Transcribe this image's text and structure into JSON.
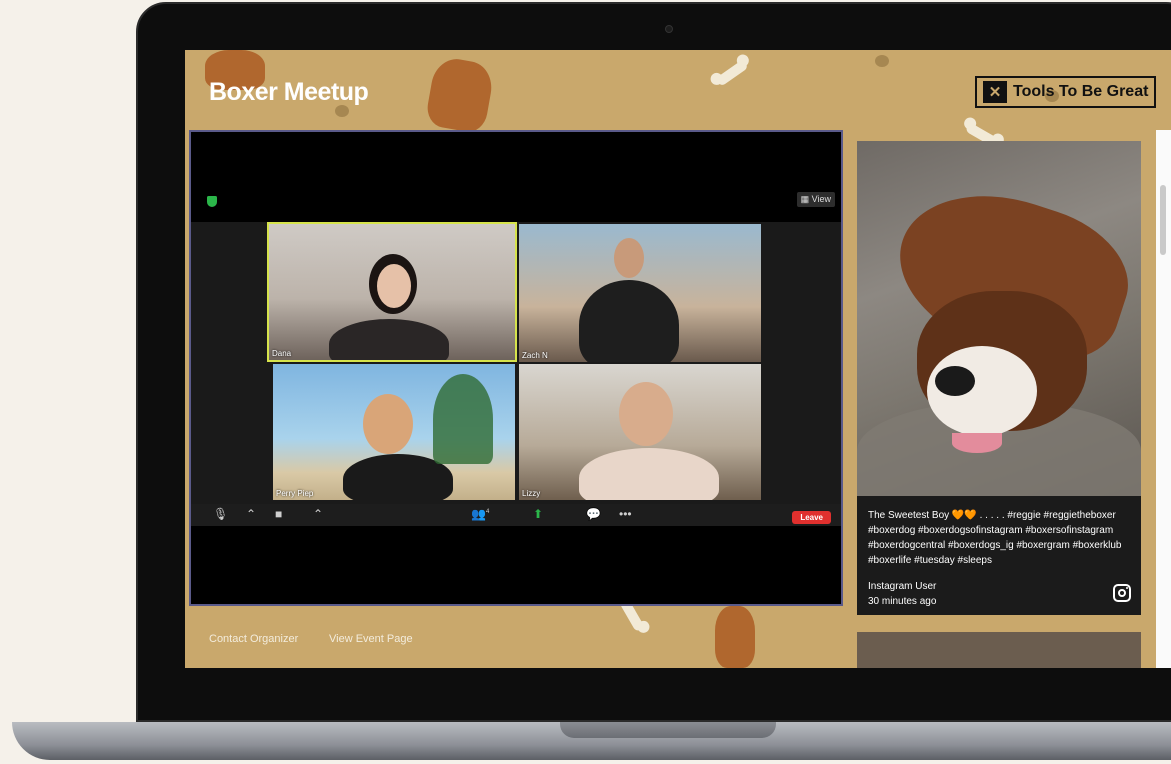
{
  "event": {
    "title": "Boxer Meetup",
    "brand": "Tools To Be Great",
    "footer_links": [
      "Contact Organizer",
      "View Event Page"
    ]
  },
  "zoom": {
    "view_label": "View",
    "participants": [
      {
        "name": "Dana"
      },
      {
        "name": "Zach N"
      },
      {
        "name": "Perry Piep"
      },
      {
        "name": "Lizzy"
      }
    ],
    "participant_count": "4",
    "leave_label": "Leave"
  },
  "instagram": {
    "caption": "The Sweetest Boy 🧡🧡 . . . . . #reggie #reggietheboxer #boxerdog #boxerdogsofinstagram #boxersofinstagram #boxerdogcentral #boxerdogs_ig #boxergram #boxerklub #boxerlife #tuesday #sleeps",
    "user": "Instagram User",
    "time": "30 minutes ago"
  },
  "colors": {
    "accent_green": "#2bb64a",
    "leave_red": "#e0302e",
    "active_speaker": "#d6e34c",
    "background_tan": "#c9a86c"
  }
}
